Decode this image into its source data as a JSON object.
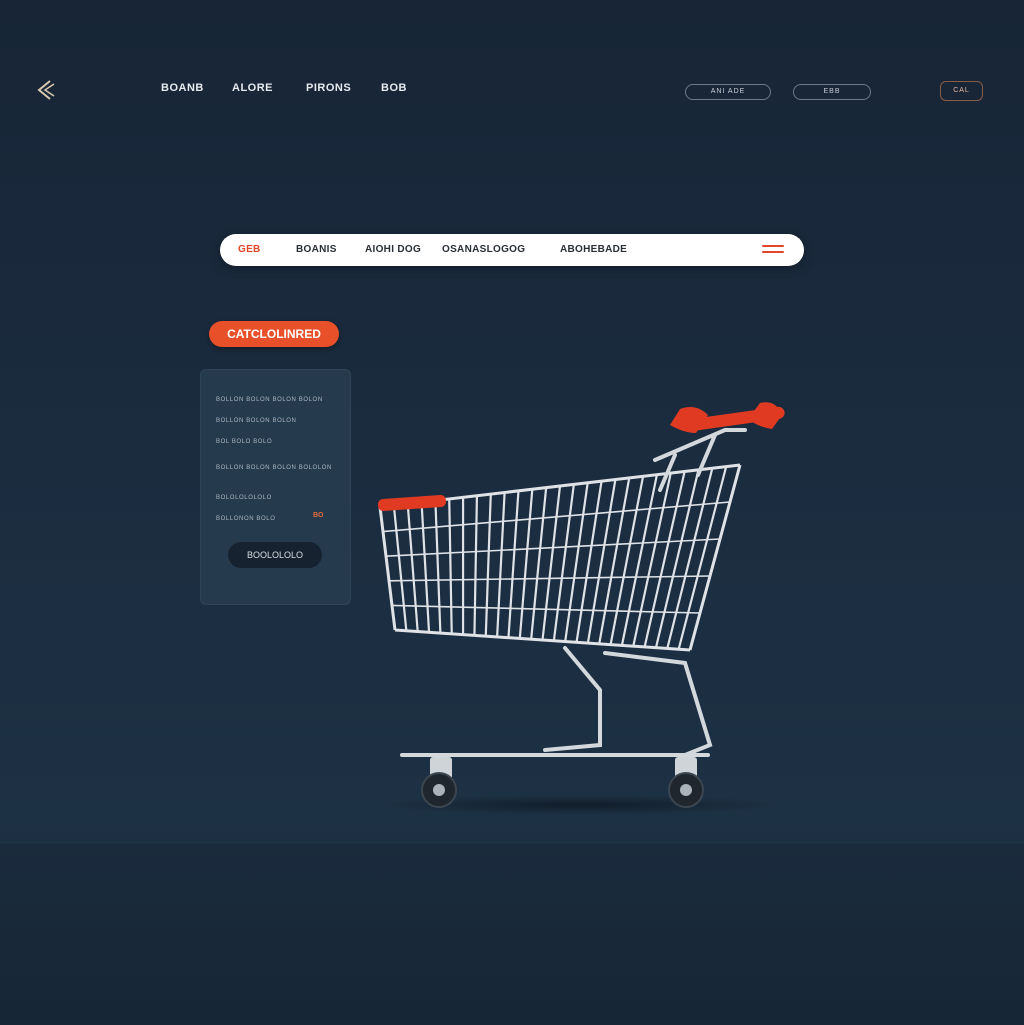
{
  "nav": {
    "items": [
      "BOANB",
      "ALORE",
      "PIRONS",
      "BOB"
    ],
    "pills": [
      "ANI ADE",
      "EBB",
      "CAL"
    ]
  },
  "categories": {
    "active": "GEB",
    "items": [
      "BOANIS",
      "AIOHI DOG",
      "OSANASLOGOG",
      "ABOHEBADE"
    ]
  },
  "cta_label": "CATCLOLINRED",
  "panel": {
    "lines": [
      "BOLLON BOLON BOLON BOLON",
      "BOLLON BOLON BOLON",
      "BOL BOLO BOLO",
      "BOLLON BOLON BOLON BOLOLON",
      "BOLOLOLOLOLO",
      "BOLLONON BOLO"
    ],
    "price": "BO",
    "button_label": "BOOLOLOLO"
  },
  "colors": {
    "background": "#1b2c3f",
    "accent": "#e8502a",
    "panel": "#263a4d"
  },
  "icons": [
    "back-arrow-icon",
    "menu-icon",
    "shopping-cart-illustration"
  ]
}
